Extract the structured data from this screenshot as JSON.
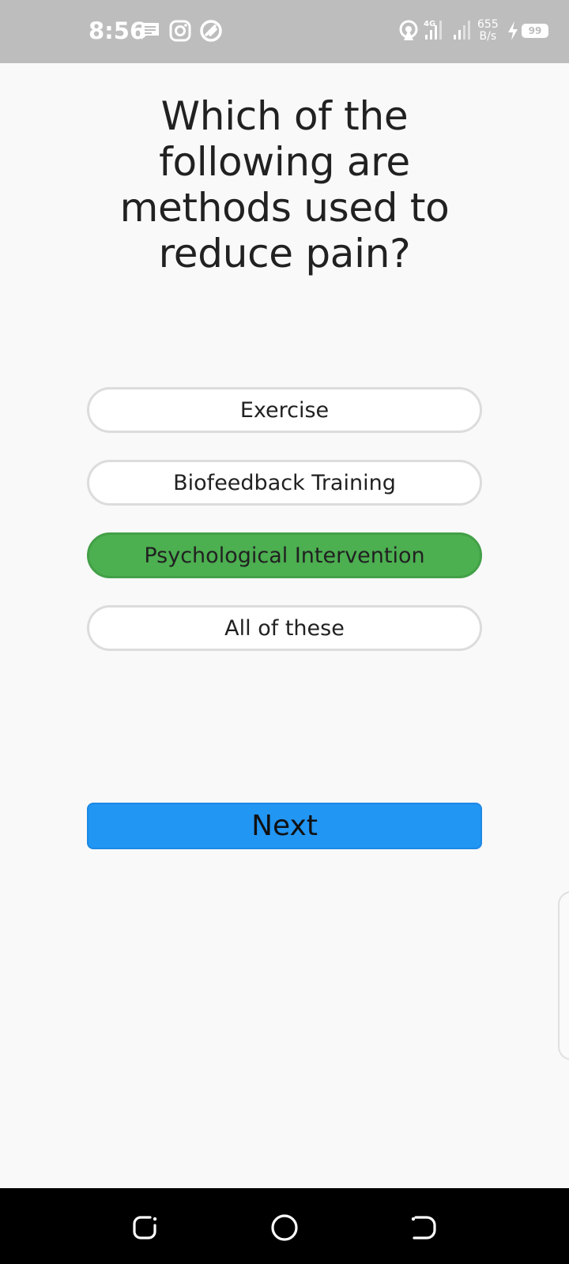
{
  "status_bar": {
    "time": "8:56",
    "net_speed_value": "655",
    "net_speed_unit": "B/s",
    "network_type": "4G",
    "battery": "99"
  },
  "quiz": {
    "question": "Which of the following are methods used to reduce pain?",
    "options": [
      {
        "label": "Exercise",
        "selected": false
      },
      {
        "label": "Biofeedback Training",
        "selected": false
      },
      {
        "label": "Psychological Intervention",
        "selected": true
      },
      {
        "label": "All of these",
        "selected": false
      }
    ],
    "next_label": "Next"
  },
  "colors": {
    "selected_option": "#4caf50",
    "next_button": "#2196f3",
    "status_bar": "#bdbdbd"
  },
  "icons": {
    "status": [
      "message-icon",
      "instagram-icon",
      "app-icon",
      "hotspot-icon",
      "signal-4g-icon",
      "signal-icon",
      "charging-icon"
    ],
    "navigation": [
      "recents-icon",
      "home-icon",
      "back-icon"
    ]
  }
}
